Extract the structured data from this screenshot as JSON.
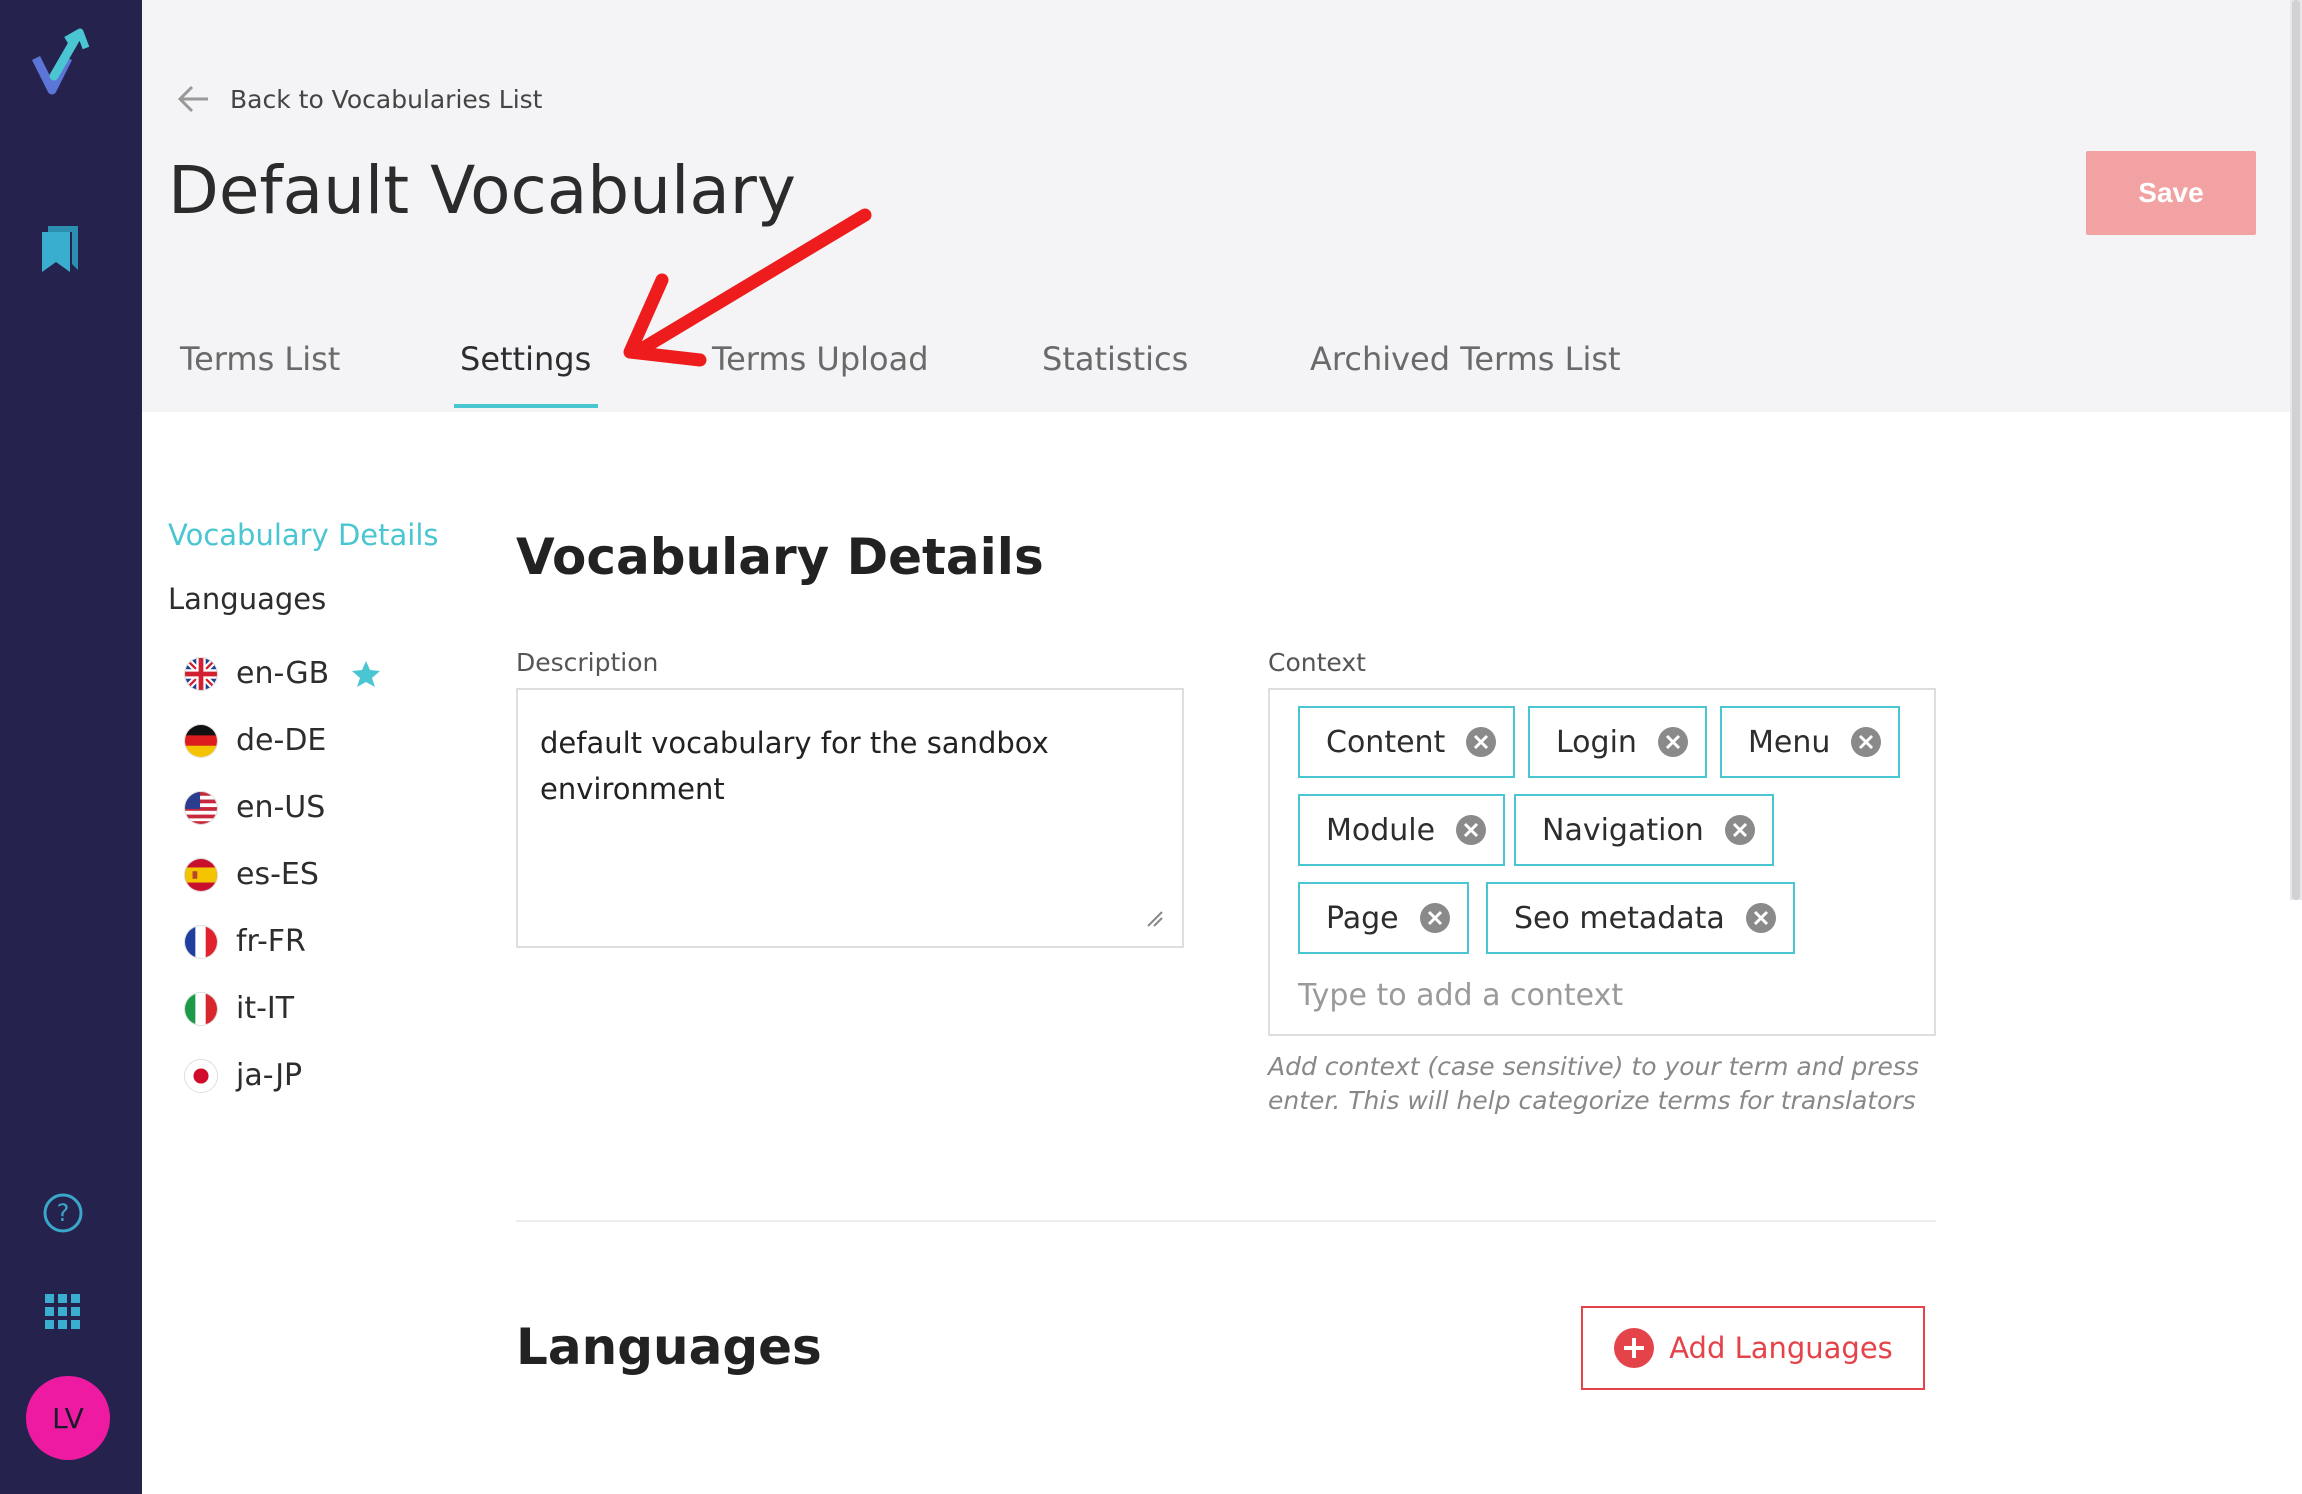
{
  "sidebar": {
    "avatar_initials": "LV",
    "icons": [
      "logo-icon",
      "bookmark-icon",
      "help-icon",
      "apps-grid-icon"
    ]
  },
  "header": {
    "back_label": "Back to Vocabularies List",
    "title": "Default Vocabulary",
    "save_label": "Save"
  },
  "tabs": [
    {
      "label": "Terms List",
      "active": false
    },
    {
      "label": "Settings",
      "active": true
    },
    {
      "label": "Terms Upload",
      "active": false
    },
    {
      "label": "Statistics",
      "active": false
    },
    {
      "label": "Archived Terms List",
      "active": false
    }
  ],
  "settings_nav": {
    "details_link": "Vocabulary Details",
    "languages_heading": "Languages",
    "languages": [
      {
        "code": "en-GB",
        "default": true
      },
      {
        "code": "de-DE",
        "default": false
      },
      {
        "code": "en-US",
        "default": false
      },
      {
        "code": "es-ES",
        "default": false
      },
      {
        "code": "fr-FR",
        "default": false
      },
      {
        "code": "it-IT",
        "default": false
      },
      {
        "code": "ja-JP",
        "default": false
      }
    ]
  },
  "details": {
    "title": "Vocabulary Details",
    "description_label": "Description",
    "description_value": "default vocabulary for the sandbox environment",
    "context_label": "Context",
    "context_chips": [
      "Content",
      "Login",
      "Menu",
      "Module",
      "Navigation",
      "Page",
      "Seo metadata"
    ],
    "context_placeholder": "Type to add a context",
    "context_help": "Add context (case sensitive) to your term and press enter. This will help categorize terms for translators"
  },
  "languages_section": {
    "title": "Languages",
    "add_label": "Add Languages"
  },
  "colors": {
    "rail": "#25234d",
    "accent": "#4ac6d2",
    "save_bg": "#f2a2a3",
    "danger": "#e4434a",
    "avatar": "#ee1aa2",
    "annotation_arrow": "#ee1c1c"
  }
}
